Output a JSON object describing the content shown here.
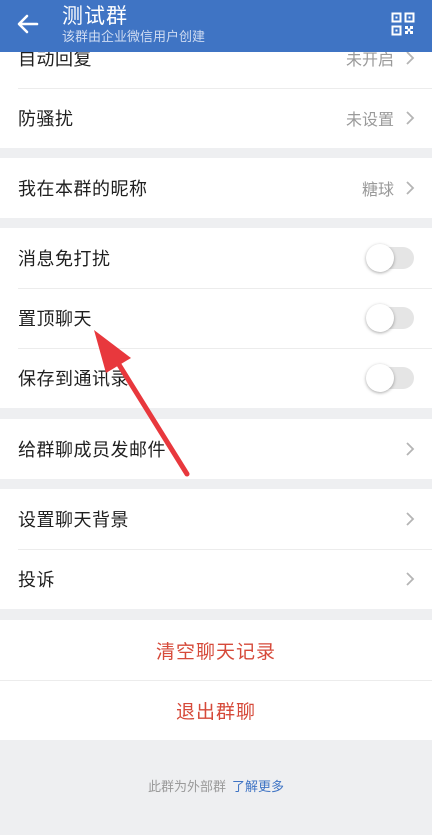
{
  "header": {
    "title": "测试群",
    "subtitle": "该群由企业微信用户创建"
  },
  "groups": [
    {
      "rows": [
        {
          "label": "自动回复",
          "value": "未开启"
        },
        {
          "label": "防骚扰",
          "value": "未设置"
        }
      ]
    },
    {
      "rows": [
        {
          "label": "我在本群的昵称",
          "value": "糖球"
        }
      ]
    },
    {
      "rows": [
        {
          "label": "消息免打扰",
          "toggle": false
        },
        {
          "label": "置顶聊天",
          "toggle": false
        },
        {
          "label": "保存到通讯录",
          "toggle": false
        }
      ]
    },
    {
      "rows": [
        {
          "label": "给群聊成员发邮件"
        }
      ]
    },
    {
      "rows": [
        {
          "label": "设置聊天背景"
        },
        {
          "label": "投诉"
        }
      ]
    }
  ],
  "actions": {
    "clear_history": "清空聊天记录",
    "quit_group": "退出群聊"
  },
  "footer": {
    "text": "此群为外部群",
    "link": "了解更多"
  },
  "colors": {
    "header_bg": "#3f74c4",
    "danger": "#d64a3a",
    "link": "#3f74c4",
    "annotation_arrow": "#e8383d"
  }
}
